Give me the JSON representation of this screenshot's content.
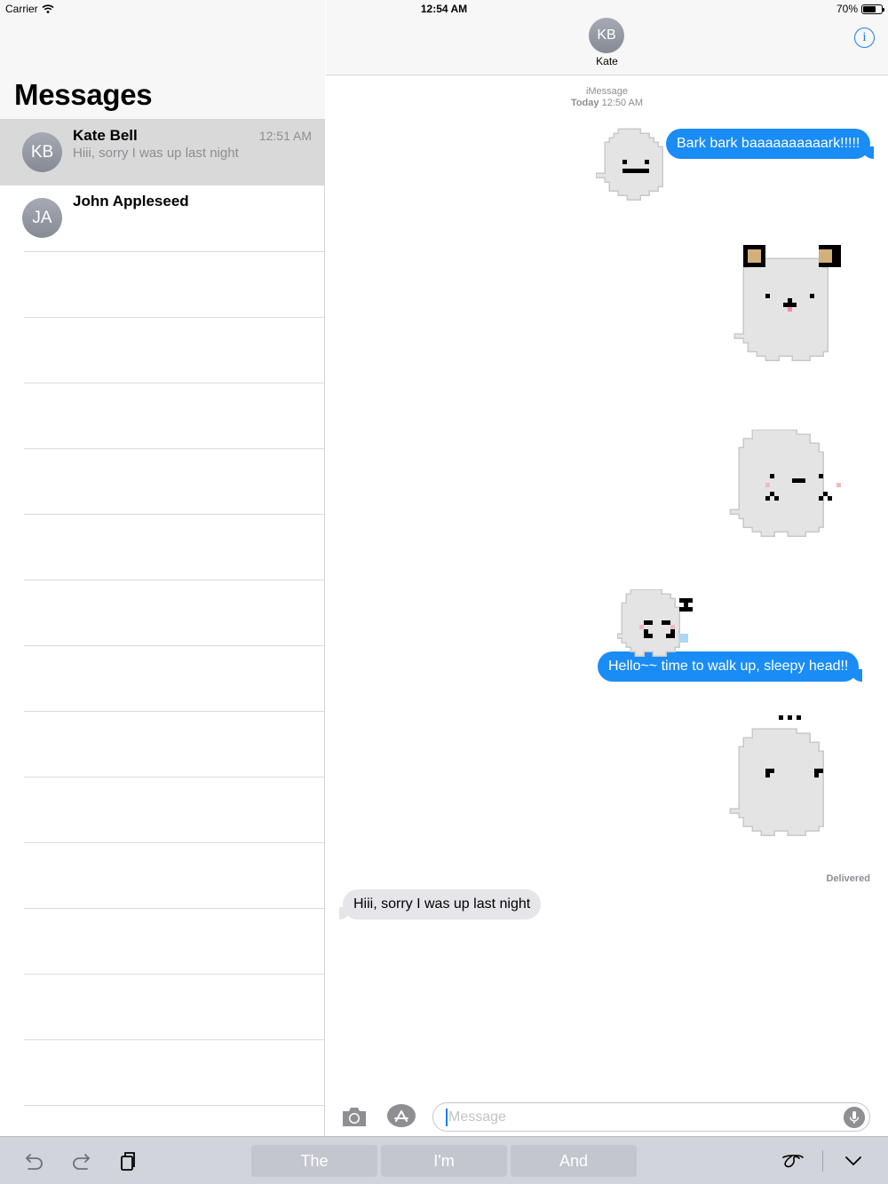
{
  "status_bar": {
    "carrier": "Carrier",
    "time": "12:54 AM",
    "battery": "70%",
    "battery_level": 0.7
  },
  "sidebar": {
    "title": "Messages",
    "conversations": [
      {
        "initials": "KB",
        "name": "Kate Bell",
        "preview": "Hiii, sorry I was up last night",
        "time": "12:51 AM",
        "selected": true
      },
      {
        "initials": "JA",
        "name": "John Appleseed",
        "preview": "",
        "time": "",
        "selected": false
      }
    ]
  },
  "conversation": {
    "contact_initials": "KB",
    "contact_name": "Kate",
    "service": "iMessage",
    "date_label": "Today",
    "date_time": "12:50 AM",
    "messages": [
      {
        "direction": "outgoing",
        "sticker": "ghost-smile-sticker",
        "text": "Bark bark baaaaaaaaaark!!!!!"
      },
      {
        "direction": "outgoing",
        "sticker": "ghost-dog-ears-sticker",
        "text": ""
      },
      {
        "direction": "outgoing",
        "sticker": "ghost-blush-sticker",
        "text": ""
      },
      {
        "direction": "outgoing",
        "sticker": "ghost-sleepy-sticker",
        "text": "Hello~~ time to walk up, sleepy head!!"
      },
      {
        "direction": "outgoing",
        "sticker": "ghost-ellipsis-sticker",
        "text": ""
      },
      {
        "direction": "incoming",
        "sticker": "",
        "text": "Hiii, sorry I was up last night"
      }
    ],
    "delivered_label": "Delivered",
    "input_placeholder": "Message"
  },
  "keyboard_bar": {
    "suggestions": [
      "The",
      "I'm",
      "And"
    ]
  },
  "icons": [
    "wifi-icon",
    "info-icon",
    "camera-icon",
    "app-store-icon",
    "mic-icon",
    "undo-icon",
    "redo-icon",
    "paste-icon",
    "handwriting-icon",
    "dismiss-keyboard-icon"
  ],
  "colors": {
    "accent_blue": "#1a8cf6",
    "incoming_bubble": "#e5e5ea",
    "header_bg": "#f7f7f7",
    "selected_row": "#d9d9d9"
  }
}
